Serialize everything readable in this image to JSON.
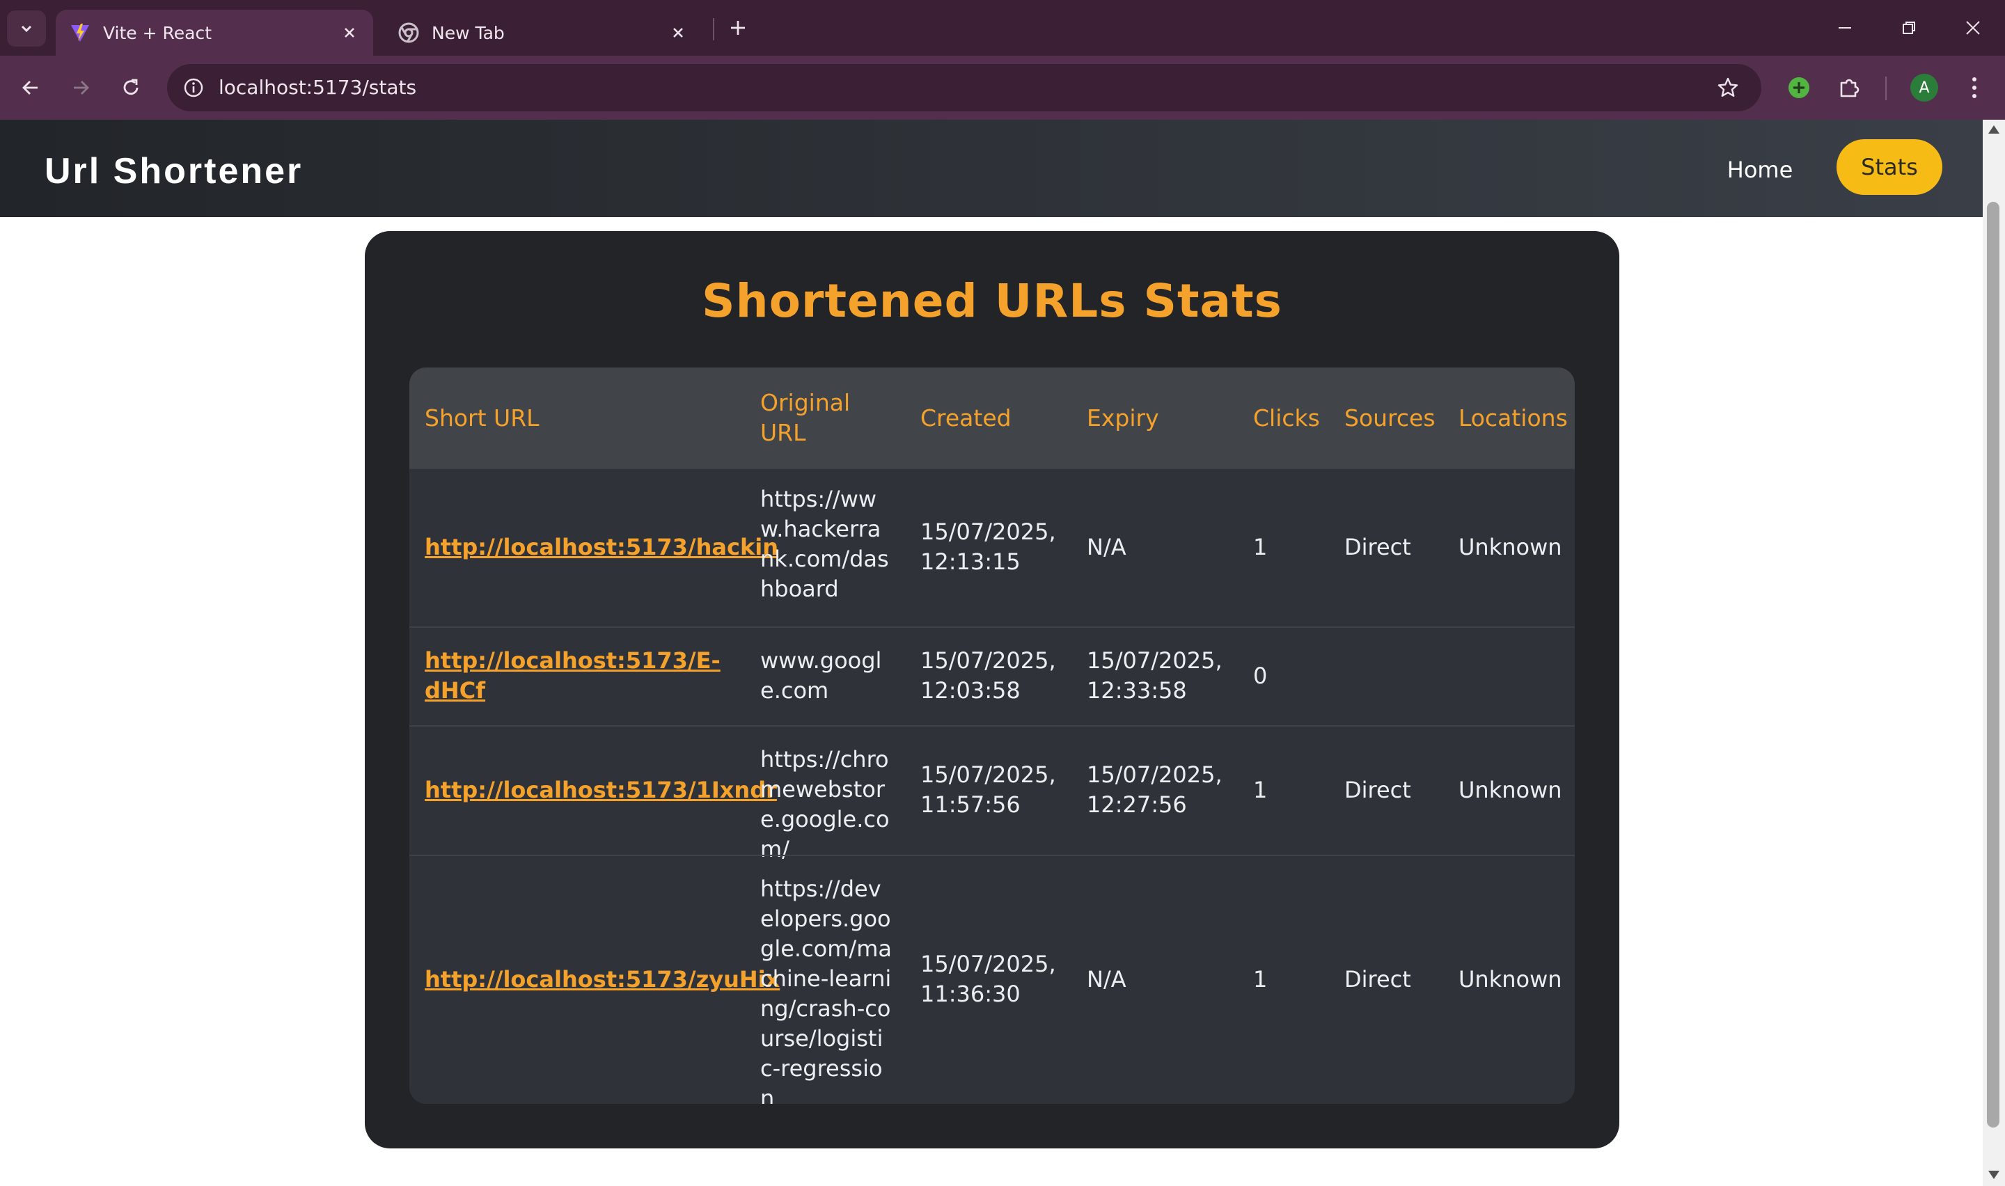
{
  "browser": {
    "tabs": [
      {
        "title": "Vite + React",
        "icon": "vite-logo-icon",
        "active": true
      },
      {
        "title": "New Tab",
        "icon": "chrome-icon",
        "active": false
      }
    ],
    "url": "localhost:5173/stats",
    "profile_initial": "A"
  },
  "header": {
    "brand": "Url Shortener",
    "nav": {
      "home": "Home",
      "stats": "Stats"
    }
  },
  "colors": {
    "accent": "#f5a22c",
    "stats_button": "#f7bb16",
    "card_bg": "#222427"
  },
  "stats": {
    "title": "Shortened URLs Stats",
    "columns": [
      "Short URL",
      "Original URL",
      "Created",
      "Expiry",
      "Clicks",
      "Sources",
      "Locations"
    ],
    "rows": [
      {
        "short_url": "http://localhost:5173/hackin",
        "original_url": "https://www.hackerrank.com/dashboard",
        "created": "15/07/2025, 12:13:15",
        "expiry": "N/A",
        "clicks": "1",
        "sources": "Direct",
        "locations": "Unknown"
      },
      {
        "short_url": "http://localhost:5173/E-dHCf",
        "original_url": "www.google.com",
        "created": "15/07/2025, 12:03:58",
        "expiry": "15/07/2025, 12:33:58",
        "clicks": "0",
        "sources": "",
        "locations": ""
      },
      {
        "short_url": "http://localhost:5173/1Ixndr",
        "original_url": "https://chromewebstore.google.com/",
        "created": "15/07/2025, 11:57:56",
        "expiry": "15/07/2025, 12:27:56",
        "clicks": "1",
        "sources": "Direct",
        "locations": "Unknown"
      },
      {
        "short_url": "http://localhost:5173/zyuHix",
        "original_url": "https://developers.google.com/machine-learning/crash-course/logistic-regression",
        "created": "15/07/2025, 11:36:30",
        "expiry": "N/A",
        "clicks": "1",
        "sources": "Direct",
        "locations": "Unknown"
      }
    ]
  }
}
